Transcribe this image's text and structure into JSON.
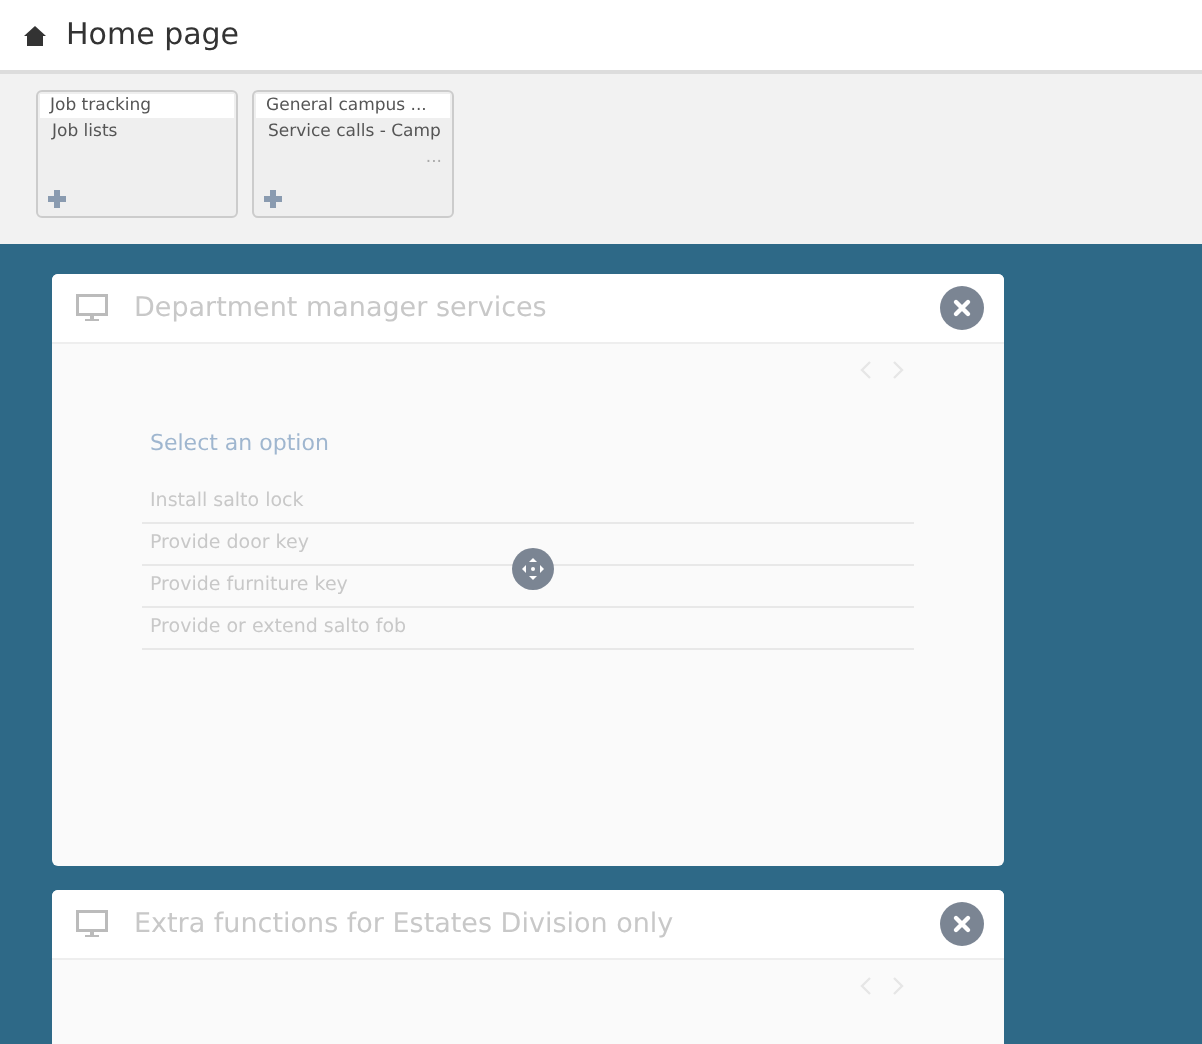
{
  "header": {
    "title": "Home page"
  },
  "tiles": [
    {
      "title": "Job tracking",
      "item": "Job lists"
    },
    {
      "title": "General campus ...",
      "item": "Service calls - Camp",
      "more": "..."
    }
  ],
  "panels": [
    {
      "title": "Department manager services",
      "prompt": "Select an option",
      "options": [
        "Install salto lock",
        "Provide door key",
        "Provide furniture key",
        "Provide or extend salto fob"
      ]
    },
    {
      "title": "Extra functions for Estates Division only"
    }
  ]
}
